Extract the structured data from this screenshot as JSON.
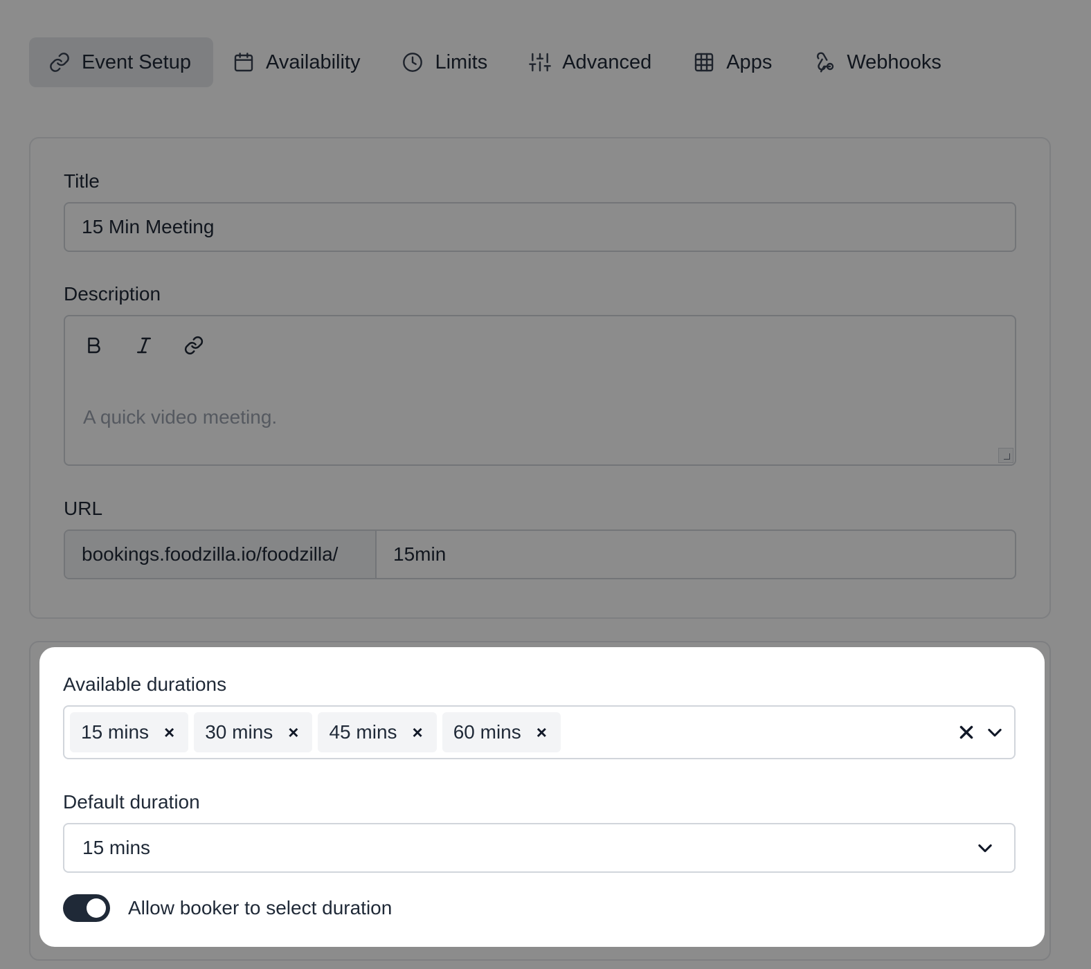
{
  "tabs": [
    {
      "label": "Event Setup",
      "icon": "link-icon",
      "active": true
    },
    {
      "label": "Availability",
      "icon": "calendar-icon"
    },
    {
      "label": "Limits",
      "icon": "clock-icon"
    },
    {
      "label": "Advanced",
      "icon": "sliders-icon"
    },
    {
      "label": "Apps",
      "icon": "grid-icon"
    },
    {
      "label": "Webhooks",
      "icon": "webhook-icon"
    }
  ],
  "event_setup": {
    "title_label": "Title",
    "title_value": "15 Min Meeting",
    "description_label": "Description",
    "description_placeholder": "A quick video meeting.",
    "url_label": "URL",
    "url_prefix": "bookings.foodzilla.io/foodzilla/",
    "url_slug": "15min"
  },
  "durations": {
    "available_label": "Available durations",
    "available": [
      "15 mins",
      "30 mins",
      "45 mins",
      "60 mins"
    ],
    "remove_glyph": "×",
    "default_label": "Default duration",
    "default_value": "15 mins",
    "allow_booker_label": "Allow booker to select duration",
    "allow_booker_enabled": true
  },
  "colors": {
    "overlay": "rgba(0,0,0,0.45)",
    "toggle_on": "#1f2937",
    "chip_bg": "#f3f4f6"
  }
}
